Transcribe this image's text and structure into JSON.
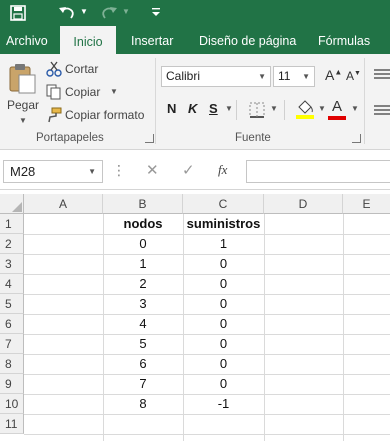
{
  "colors": {
    "brand_green": "#217346",
    "ribbon_bg": "#f3f3f3",
    "font_color_bar": "#e00000",
    "highlight_bar": "#ffff00"
  },
  "quick_access": {
    "save_icon": "save-icon",
    "undo_icon": "undo-icon",
    "redo_icon": "redo-icon",
    "customize_icon": "customize-icon"
  },
  "tabs": [
    "Archivo",
    "Inicio",
    "Insertar",
    "Diseño de página",
    "Fórmulas"
  ],
  "clipboard": {
    "paste_label": "Pegar",
    "cut_label": "Cortar",
    "copy_label": "Copiar",
    "format_painter_label": "Copiar formato",
    "group_title": "Portapapeles"
  },
  "font": {
    "name": "Calibri",
    "size": "11",
    "bold_label": "N",
    "italic_label": "K",
    "underline_label": "S",
    "group_title": "Fuente",
    "grow_label": "A",
    "shrink_label": "A",
    "color_label": "A"
  },
  "formula_bar": {
    "name_box": "M28",
    "fx_label": "fx",
    "value": ""
  },
  "columns": [
    "A",
    "B",
    "C",
    "D",
    "E"
  ],
  "rows": [
    "1",
    "2",
    "3",
    "4",
    "5",
    "6",
    "7",
    "8",
    "9",
    "10",
    "11"
  ],
  "sheet": {
    "header_b": "nodos",
    "header_c": "suministros",
    "nodos": [
      "0",
      "1",
      "2",
      "3",
      "4",
      "5",
      "6",
      "7",
      "8"
    ],
    "suministros": [
      "1",
      "0",
      "0",
      "0",
      "0",
      "0",
      "0",
      "0",
      "-1"
    ]
  }
}
